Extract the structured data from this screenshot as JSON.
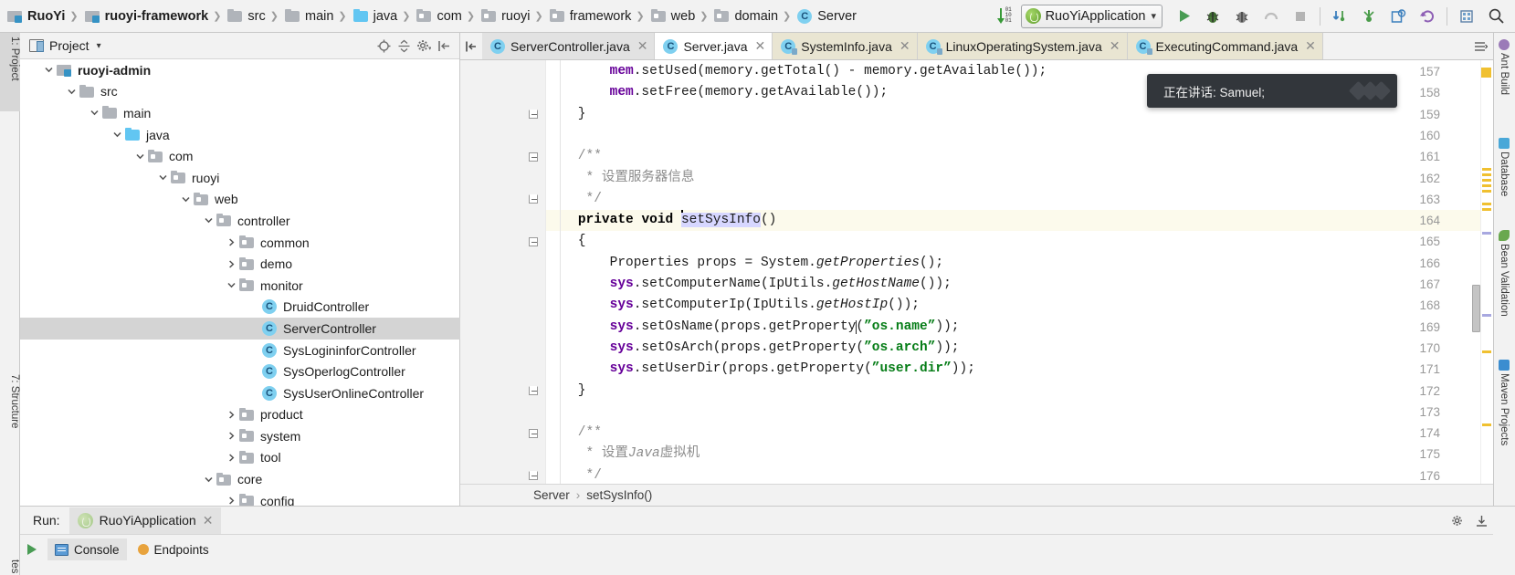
{
  "navbar": {
    "crumbs": [
      {
        "label": "RuoYi",
        "icon": "module-icon",
        "bold": true
      },
      {
        "label": "ruoyi-framework",
        "icon": "module-icon",
        "bold": true
      },
      {
        "label": "src",
        "icon": "folder-icon",
        "bold": false
      },
      {
        "label": "main",
        "icon": "folder-icon",
        "bold": false
      },
      {
        "label": "java",
        "icon": "source-folder-icon",
        "bold": false
      },
      {
        "label": "com",
        "icon": "package-icon",
        "bold": false
      },
      {
        "label": "ruoyi",
        "icon": "package-icon",
        "bold": false
      },
      {
        "label": "framework",
        "icon": "package-icon",
        "bold": false
      },
      {
        "label": "web",
        "icon": "package-icon",
        "bold": false
      },
      {
        "label": "domain",
        "icon": "package-icon",
        "bold": false
      },
      {
        "label": "Server",
        "icon": "class-icon",
        "bold": false
      }
    ],
    "run_config": "RuoYiApplication",
    "toolbar_icons": [
      "sort-alphabetically-icon",
      "run-icon",
      "debug-icon",
      "run-coverage-icon",
      "profile-icon",
      "stop-icon",
      "update-project-icon",
      "commit-icon",
      "history-icon",
      "rollback-icon",
      "settings-icon",
      "search-everywhere-icon"
    ]
  },
  "left_rail": {
    "tabs": [
      {
        "label": "1: Project",
        "selected": true
      },
      {
        "label": "7: Structure",
        "selected": false
      },
      {
        "label": "tes",
        "selected": false
      }
    ]
  },
  "project_panel": {
    "title": "Project",
    "header_icons": [
      "locate-icon",
      "collapse-all-icon",
      "gear-icon",
      "hide-icon"
    ],
    "tree": [
      {
        "label": "ruoyi-admin",
        "depth": 1,
        "twisty": "down",
        "icon": "module-icon",
        "bold": true,
        "selected": false
      },
      {
        "label": "src",
        "depth": 2,
        "twisty": "down",
        "icon": "folder-icon",
        "bold": false,
        "selected": false
      },
      {
        "label": "main",
        "depth": 3,
        "twisty": "down",
        "icon": "folder-icon",
        "bold": false,
        "selected": false
      },
      {
        "label": "java",
        "depth": 4,
        "twisty": "down",
        "icon": "source-folder-icon",
        "bold": false,
        "selected": false
      },
      {
        "label": "com",
        "depth": 5,
        "twisty": "down",
        "icon": "package-icon",
        "bold": false,
        "selected": false
      },
      {
        "label": "ruoyi",
        "depth": 6,
        "twisty": "down",
        "icon": "package-icon",
        "bold": false,
        "selected": false
      },
      {
        "label": "web",
        "depth": 7,
        "twisty": "down",
        "icon": "package-icon",
        "bold": false,
        "selected": false
      },
      {
        "label": "controller",
        "depth": 8,
        "twisty": "down",
        "icon": "package-icon",
        "bold": false,
        "selected": false
      },
      {
        "label": "common",
        "depth": 9,
        "twisty": "right",
        "icon": "package-icon",
        "bold": false,
        "selected": false
      },
      {
        "label": "demo",
        "depth": 9,
        "twisty": "right",
        "icon": "package-icon",
        "bold": false,
        "selected": false
      },
      {
        "label": "monitor",
        "depth": 9,
        "twisty": "down",
        "icon": "package-icon",
        "bold": false,
        "selected": false
      },
      {
        "label": "DruidController",
        "depth": 10,
        "twisty": "none",
        "icon": "class-icon",
        "bold": false,
        "selected": false
      },
      {
        "label": "ServerController",
        "depth": 10,
        "twisty": "none",
        "icon": "class-icon",
        "bold": false,
        "selected": true
      },
      {
        "label": "SysLogininforController",
        "depth": 10,
        "twisty": "none",
        "icon": "class-icon",
        "bold": false,
        "selected": false
      },
      {
        "label": "SysOperlogController",
        "depth": 10,
        "twisty": "none",
        "icon": "class-icon",
        "bold": false,
        "selected": false
      },
      {
        "label": "SysUserOnlineController",
        "depth": 10,
        "twisty": "none",
        "icon": "class-icon",
        "bold": false,
        "selected": false
      },
      {
        "label": "product",
        "depth": 9,
        "twisty": "right",
        "icon": "package-icon",
        "bold": false,
        "selected": false
      },
      {
        "label": "system",
        "depth": 9,
        "twisty": "right",
        "icon": "package-icon",
        "bold": false,
        "selected": false
      },
      {
        "label": "tool",
        "depth": 9,
        "twisty": "right",
        "icon": "package-icon",
        "bold": false,
        "selected": false
      },
      {
        "label": "core",
        "depth": 8,
        "twisty": "down",
        "icon": "package-icon",
        "bold": false,
        "selected": false
      },
      {
        "label": "config",
        "depth": 9,
        "twisty": "right",
        "icon": "package-icon",
        "bold": false,
        "selected": false
      }
    ]
  },
  "editor": {
    "tabs": [
      {
        "label": "ServerController.java",
        "state": "inactive",
        "locked": false
      },
      {
        "label": "Server.java",
        "state": "active",
        "locked": false
      },
      {
        "label": "SystemInfo.java",
        "state": "library",
        "locked": true
      },
      {
        "label": "LinuxOperatingSystem.java",
        "state": "library",
        "locked": true
      },
      {
        "label": "ExecutingCommand.java",
        "state": "library",
        "locked": true
      }
    ],
    "first_line": 157,
    "lines": [
      {
        "no": 157,
        "fold": "none",
        "highlight": false
      },
      {
        "no": 158,
        "fold": "none",
        "highlight": false
      },
      {
        "no": 159,
        "fold": "end",
        "highlight": false
      },
      {
        "no": 160,
        "fold": "none",
        "highlight": false
      },
      {
        "no": 161,
        "fold": "start",
        "highlight": false
      },
      {
        "no": 162,
        "fold": "none",
        "highlight": false
      },
      {
        "no": 163,
        "fold": "end",
        "highlight": false
      },
      {
        "no": 164,
        "fold": "none",
        "highlight": true
      },
      {
        "no": 165,
        "fold": "start",
        "highlight": false
      },
      {
        "no": 166,
        "fold": "none",
        "highlight": false
      },
      {
        "no": 167,
        "fold": "none",
        "highlight": false
      },
      {
        "no": 168,
        "fold": "none",
        "highlight": false
      },
      {
        "no": 169,
        "fold": "none",
        "highlight": false
      },
      {
        "no": 170,
        "fold": "none",
        "highlight": false
      },
      {
        "no": 171,
        "fold": "none",
        "highlight": false
      },
      {
        "no": 172,
        "fold": "end",
        "highlight": false
      },
      {
        "no": 173,
        "fold": "none",
        "highlight": false
      },
      {
        "no": 174,
        "fold": "start",
        "highlight": false
      },
      {
        "no": 175,
        "fold": "none",
        "highlight": false
      },
      {
        "no": 176,
        "fold": "end",
        "highlight": false
      }
    ],
    "code_text": [
      "        mem.setUsed(memory.getTotal() - memory.getAvailable());",
      "        mem.setFree(memory.getAvailable());",
      "    }",
      "",
      "    /**",
      "     * 设置服务器信息",
      "     */",
      "    private void setSysInfo()",
      "    {",
      "        Properties props = System.getProperties();",
      "        sys.setComputerName(IpUtils.getHostName());",
      "        sys.setComputerIp(IpUtils.getHostIp());",
      "        sys.setOsName(props.getProperty(\"os.name\"));",
      "        sys.setOsArch(props.getProperty(\"os.arch\"));",
      "        sys.setUserDir(props.getProperty(\"user.dir\"));",
      "    }",
      "",
      "    /**",
      "     * 设置Java虚拟机",
      "     */"
    ],
    "selected_token": "setSysInfo",
    "breadcrumb": {
      "class": "Server",
      "separator": "›",
      "method": "setSysInfo()"
    }
  },
  "toast": {
    "message": "正在讲话: Samuel;"
  },
  "right_rail": {
    "tabs": [
      {
        "label": "Ant Build",
        "icon": "ant-icon",
        "color": "#9b7bb8"
      },
      {
        "label": "Database",
        "icon": "database-icon",
        "color": "#4aa8d8"
      },
      {
        "label": "Bean Validation",
        "icon": "bean-icon",
        "color": "#6aa84f"
      },
      {
        "label": "Maven Projects",
        "icon": "maven-icon",
        "color": "#3b8dd0"
      }
    ]
  },
  "run_panel": {
    "label": "Run:",
    "tab": "RuoYiApplication",
    "buttons": [
      "rerun-icon",
      "gear-icon",
      "hide-icon"
    ],
    "bottom_tabs": [
      {
        "label": "Console",
        "icon": "console-icon"
      },
      {
        "label": "Endpoints",
        "icon": "endpoints-icon"
      }
    ]
  },
  "bottom_left_rail": {
    "label": "tes"
  },
  "colors": {
    "accent_blue": "#3592c4",
    "class_icon": "#7fd0f0",
    "string_green": "#067d17",
    "field_purple": "#660099",
    "highlight_line": "#fcfaec",
    "selection": "#d7d7ff",
    "toast_bg": "#32363b"
  }
}
